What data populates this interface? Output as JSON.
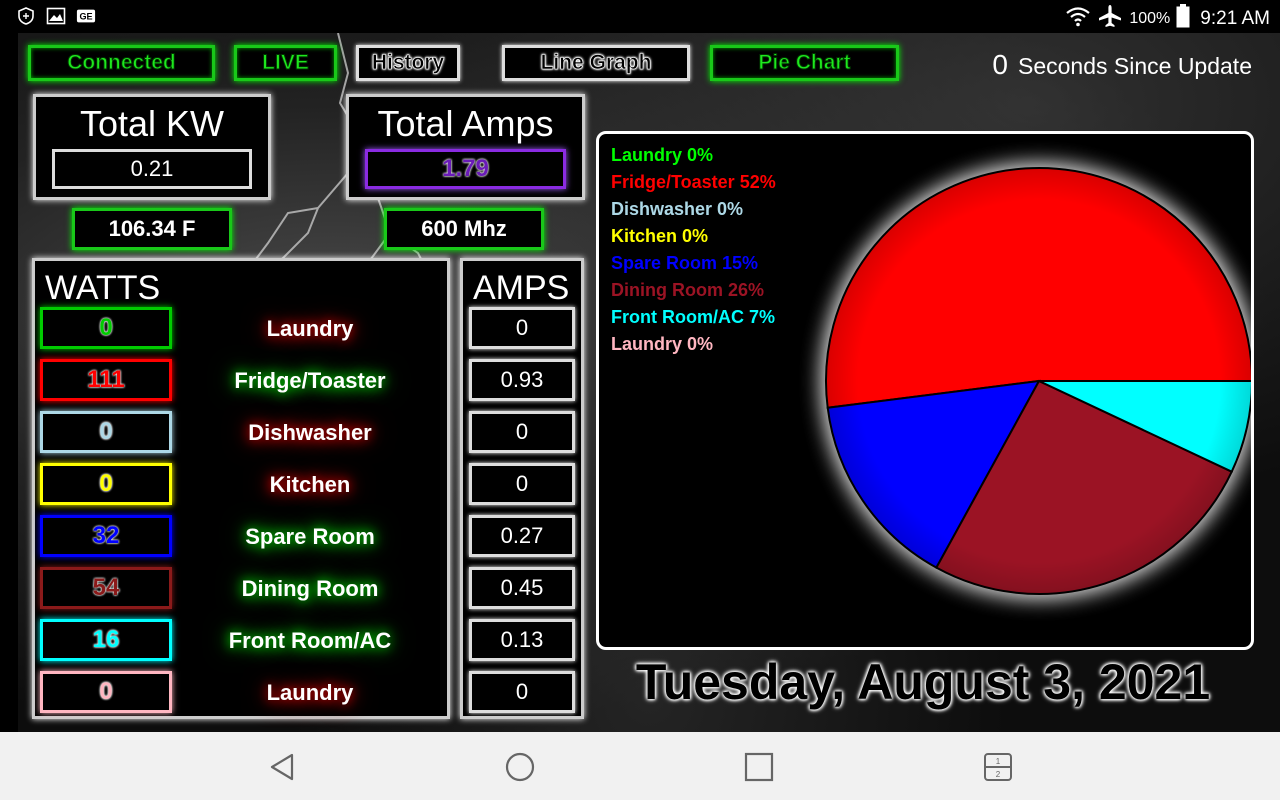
{
  "statusbar": {
    "battery": "100%",
    "time": "9:21 AM",
    "left_icons": [
      "shield-icon",
      "image-icon",
      "ge-icon"
    ],
    "right_icons": [
      "wifi-icon",
      "airplane-icon",
      "battery-icon"
    ]
  },
  "toolbar": {
    "connected": "Connected",
    "live": "LIVE",
    "history": "History",
    "line_graph": "Line Graph",
    "pie_chart": "Pie Chart"
  },
  "update": {
    "seconds": "0",
    "label": "Seconds Since Update"
  },
  "summary": {
    "total_kw_title": "Total KW",
    "total_kw_value": "0.21",
    "total_amps_title": "Total Amps",
    "total_amps_value": "1.79",
    "temperature": "106.34 F",
    "frequency": "600 Mhz"
  },
  "watts": {
    "title": "WATTS",
    "rows": [
      {
        "value": "0",
        "label": "Laundry",
        "color": "#00cc00",
        "glow": "red"
      },
      {
        "value": "111",
        "label": "Fridge/Toaster",
        "color": "#ff0000",
        "glow": "green"
      },
      {
        "value": "0",
        "label": "Dishwasher",
        "color": "#add8e6",
        "glow": "red"
      },
      {
        "value": "0",
        "label": "Kitchen",
        "color": "#ffff00",
        "glow": "red"
      },
      {
        "value": "32",
        "label": "Spare Room",
        "color": "#0000ff",
        "glow": "green"
      },
      {
        "value": "54",
        "label": "Dining Room",
        "color": "#8b1a1a",
        "glow": "green"
      },
      {
        "value": "16",
        "label": "Front Room/AC",
        "color": "#00ffff",
        "glow": "green"
      },
      {
        "value": "0",
        "label": "Laundry",
        "color": "#ffb6c1",
        "glow": "red"
      }
    ]
  },
  "amps": {
    "title": "AMPS",
    "values": [
      "0",
      "0.93",
      "0",
      "0",
      "0.27",
      "0.45",
      "0.13",
      "0"
    ]
  },
  "date": "Tuesday, August 3, 2021",
  "chart_data": {
    "type": "pie",
    "title": "",
    "legend_position": "top-left",
    "series": [
      {
        "name": "Laundry 0%",
        "value": 0,
        "color": "#00ff00"
      },
      {
        "name": "Fridge/Toaster 52%",
        "value": 52,
        "color": "#ff0000"
      },
      {
        "name": "Dishwasher 0%",
        "value": 0,
        "color": "#add8e6"
      },
      {
        "name": "Kitchen 0%",
        "value": 0,
        "color": "#ffff00"
      },
      {
        "name": "Spare Room 15%",
        "value": 15,
        "color": "#0000ff"
      },
      {
        "name": "Dining Room 26%",
        "value": 26,
        "color": "#9b1324"
      },
      {
        "name": "Front Room/AC 7%",
        "value": 7,
        "color": "#00ffff"
      },
      {
        "name": "Laundry 0%",
        "value": 0,
        "color": "#ffb6c1"
      }
    ]
  },
  "navbar": {
    "icons": [
      "back-icon",
      "home-icon",
      "recents-icon",
      "split-screen-icon"
    ]
  }
}
